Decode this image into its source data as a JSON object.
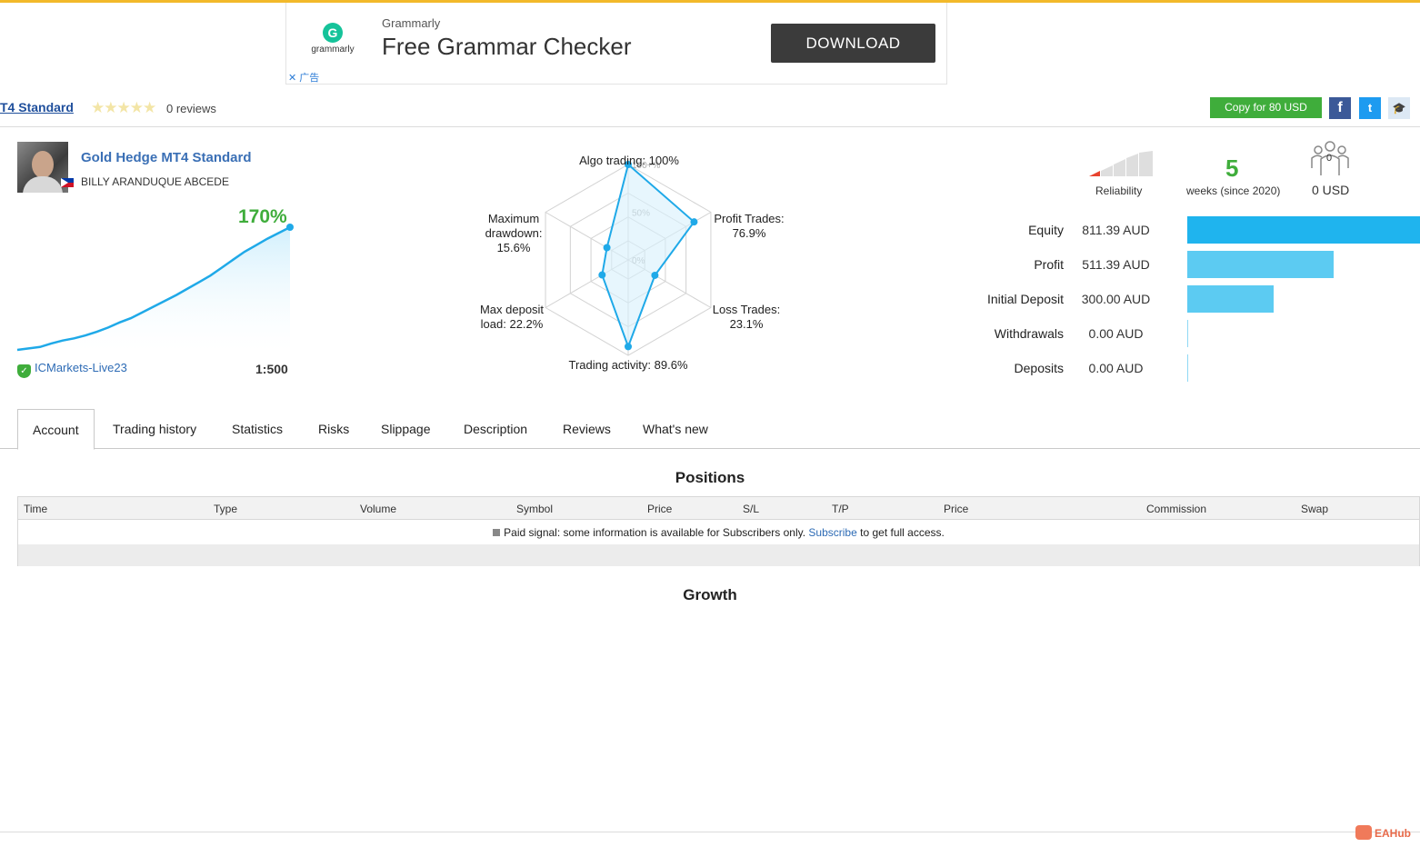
{
  "ad": {
    "logo_letter": "G",
    "logo_label": "grammarly",
    "brand": "Grammarly",
    "title": "Free Grammar Checker",
    "button": "DOWNLOAD",
    "close": "✕ 广告"
  },
  "header": {
    "title": "T4 Standard",
    "stars": "★★★★★",
    "reviews": "0 reviews",
    "copy_button": "Copy for 80 USD",
    "facebook": "f",
    "twitter": "t",
    "edu": "🎓"
  },
  "signal": {
    "name": "Gold Hedge MT4 Standard",
    "owner": "BILLY ARANDUQUE ABCEDE",
    "growth": "170%",
    "broker": "ICMarkets-Live23",
    "leverage": "1:500",
    "growth_curve": [
      0,
      2,
      4,
      9,
      13,
      16,
      20,
      25,
      31,
      38,
      44,
      52,
      60,
      68,
      76,
      85,
      94,
      103,
      114,
      125,
      136,
      145,
      154,
      162,
      170
    ]
  },
  "radar": {
    "grid_labels": [
      "100+%",
      "50%",
      "0%"
    ],
    "axes": [
      {
        "label": "Algo trading: 100%",
        "value": 100
      },
      {
        "label": "Profit Trades:\n76.9%",
        "value": 76.9
      },
      {
        "label": "Loss Trades:\n23.1%",
        "value": 23.1
      },
      {
        "label": "Trading activity: 89.6%",
        "value": 89.6
      },
      {
        "label": "Max deposit\nload: 22.2%",
        "value": 22.2
      },
      {
        "label": "Maximum\ndrawdown:\n15.6%",
        "value": 15.6
      }
    ],
    "line_color": "#1fa9e8"
  },
  "stats": {
    "reliability_label": "Reliability",
    "weeks": "5",
    "weeks_label": "weeks (since 2020)",
    "subscribers": "0",
    "subscription_price": "0 USD"
  },
  "balances": [
    {
      "label": "Equity",
      "value": "811.39 AUD",
      "amount": 811.39
    },
    {
      "label": "Profit",
      "value": "511.39 AUD",
      "amount": 511.39
    },
    {
      "label": "Initial Deposit",
      "value": "300.00 AUD",
      "amount": 300.0
    },
    {
      "label": "Withdrawals",
      "value": "0.00 AUD",
      "amount": 0
    },
    {
      "label": "Deposits",
      "value": "0.00 AUD",
      "amount": 0
    }
  ],
  "tabs": [
    "Account",
    "Trading history",
    "Statistics",
    "Risks",
    "Slippage",
    "Description",
    "Reviews",
    "What's new"
  ],
  "positions": {
    "title": "Positions",
    "columns": [
      "Time",
      "Type",
      "Volume",
      "Symbol",
      "Price",
      "S/L",
      "T/P",
      "Price",
      "Commission",
      "Swap"
    ],
    "notice_pre": "Paid signal: some information is available for Subscribers only.",
    "notice_link": "Subscribe",
    "notice_post": "to get full access."
  },
  "growth_section": {
    "title": "Growth"
  },
  "watermark": "EAHub",
  "colors": {
    "accent_green": "#3fad3b",
    "link_blue": "#2d6bb5",
    "bar_blue": "#5ccbf2",
    "top_line": "#f2b92b"
  }
}
